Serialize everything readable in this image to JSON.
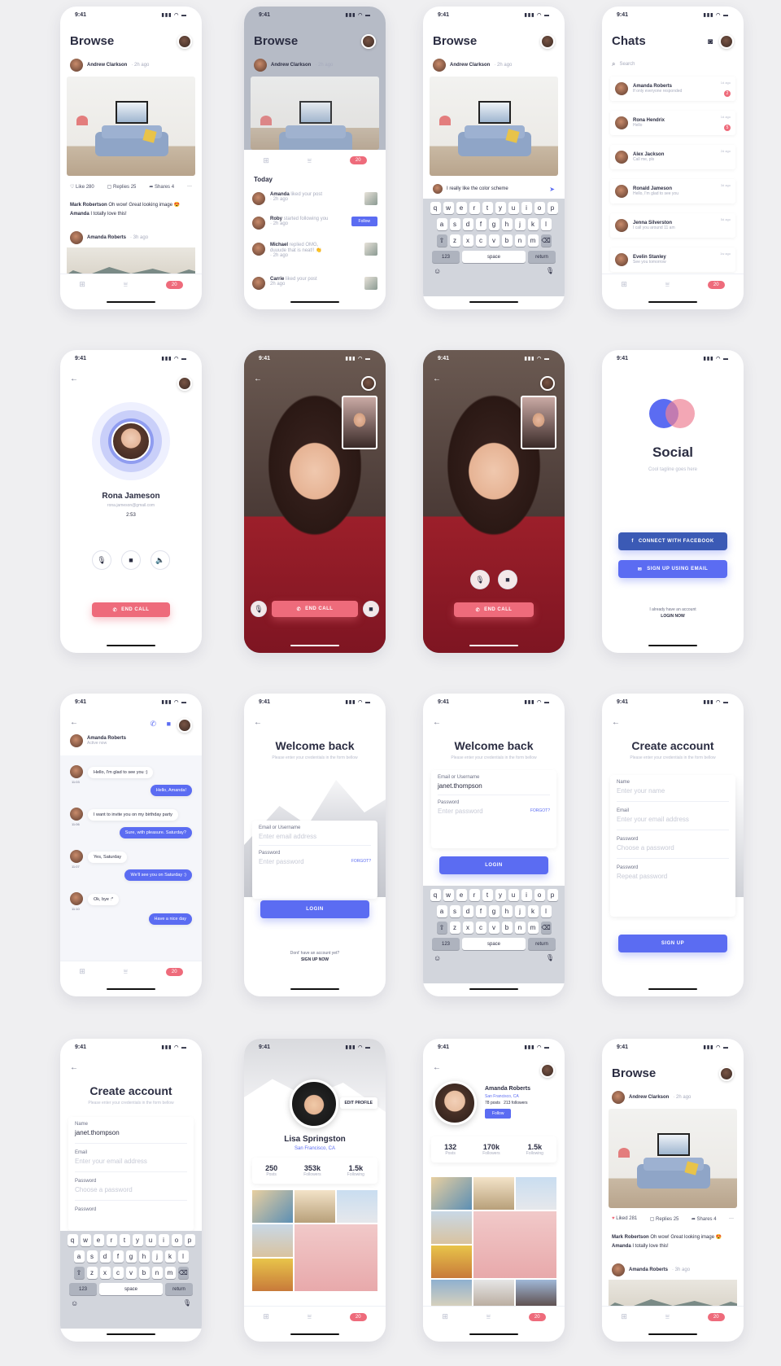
{
  "status": {
    "time": "9:41",
    "icons": "▮▮▮ ◠ ▬"
  },
  "tabs": {
    "grid": "⊞",
    "filter": "⩸",
    "badge": "20"
  },
  "browse": {
    "title": "Browse",
    "author": "Andrew Clarkson",
    "time": "· 2h ago",
    "likes": "Like 280",
    "liked": "Liked 281",
    "replies": "Replies 25",
    "shares": "Shares 4",
    "more": "···",
    "c1_name": "Mark Robertson",
    "c1_text": " Oh wow! Great looking image 😍",
    "c2_name": "Amanda",
    "c2_text": " I totally love this!",
    "next_author": "Amanda Roberts",
    "next_time": "· 3h ago"
  },
  "notifs": {
    "today": "Today",
    "follow": "Follow",
    "items": [
      {
        "name": "Amanda",
        "text": " liked your post",
        "time": "· 2h ago"
      },
      {
        "name": "Roby",
        "text": " started following you",
        "time": "· 2h ago"
      },
      {
        "name": "Michael",
        "text": " replied OMG, duuude that is neat!! 👏",
        "time": "· 2h ago"
      },
      {
        "name": "Carrie",
        "text": " liked your post",
        "time": "2h ago"
      }
    ]
  },
  "compose": {
    "text": "I really like the color scheme"
  },
  "keyboard": {
    "row1": [
      "q",
      "w",
      "e",
      "r",
      "t",
      "y",
      "u",
      "i",
      "o",
      "p"
    ],
    "row2": [
      "a",
      "s",
      "d",
      "f",
      "g",
      "h",
      "j",
      "k",
      "l"
    ],
    "row3": [
      "z",
      "x",
      "c",
      "v",
      "b",
      "n",
      "m"
    ],
    "num": "123",
    "space": "space",
    "ret": "return",
    "shift": "⇧",
    "del": "⌫",
    "emoji": "☺",
    "mic": "🎙"
  },
  "chats": {
    "title": "Chats",
    "search": "Search",
    "items": [
      {
        "name": "Amanda Roberts",
        "msg": "If only everyone responded",
        "time": "1d ago",
        "badge": "2"
      },
      {
        "name": "Rona Hendrix",
        "msg": "Hello",
        "time": "1d ago",
        "badge": "5"
      },
      {
        "name": "Alex Jackson",
        "msg": "Call me, pls",
        "time": "2d ago",
        "badge": ""
      },
      {
        "name": "Ronald Jameson",
        "msg": "Hello, I'm glad to see you",
        "time": "3d ago",
        "badge": ""
      },
      {
        "name": "Jenna Silverston",
        "msg": "I call you around 11 am",
        "time": "5d ago",
        "badge": ""
      },
      {
        "name": "Evelin Stanley",
        "msg": "See you tomorrow",
        "time": "1w ago",
        "badge": ""
      }
    ]
  },
  "call": {
    "name": "Rona Jameson",
    "email": "rona.jameson@gmail.com",
    "duration": "2:53",
    "end": "END CALL"
  },
  "social": {
    "title": "Social",
    "tagline": "Cool tagline goes here",
    "facebook": "CONNECT WITH FACEBOOK",
    "email": "SIGN UP USING EMAIL",
    "have": "I already have an account",
    "login": "LOGIN NOW"
  },
  "conv": {
    "name": "Amanda Roberts",
    "status": "Active now",
    "msgs": [
      {
        "text": "Hello, I'm glad to see you :)",
        "me": false,
        "time": "11:03"
      },
      {
        "text": "Hello, Amanda!",
        "me": true,
        "time": ""
      },
      {
        "text": "I want to invite you on my birthday party",
        "me": false,
        "time": "11:06"
      },
      {
        "text": "Sure, with pleasure. Saturday?",
        "me": true,
        "time": ""
      },
      {
        "text": "Yes, Saturday",
        "me": false,
        "time": "11:07"
      },
      {
        "text": "We'll see you on Saturday :)",
        "me": true,
        "time": ""
      },
      {
        "text": "Ok, bye :*",
        "me": false,
        "time": "11:10"
      },
      {
        "text": "Have a nice day",
        "me": true,
        "time": ""
      }
    ]
  },
  "login": {
    "title": "Welcome back",
    "sub": "Please enter your credentials in the form bellow",
    "email_label": "Email or Username",
    "email_ph": "Enter email address",
    "email_val": "janet.thompson",
    "pass_label": "Password",
    "pass_ph": "Enter password",
    "forgot": "FORGOT?",
    "btn": "LOGIN",
    "no_acc": "Dont' have an account yet?",
    "signup": "SIGN UP NOW"
  },
  "create": {
    "title": "Create account",
    "sub": "Please enter your credentials in the form bellow",
    "name_label": "Name",
    "name_ph": "Enter your name",
    "name_val": "janet.thompson",
    "email_label": "Email",
    "email_ph": "Enter your email address",
    "pass_label": "Password",
    "pass_ph": "Choose a password",
    "rep_label": "Password",
    "rep_ph": "Repeat password",
    "btn": "SIGN UP"
  },
  "profile1": {
    "name": "Lisa Springston",
    "loc": "San Francisco, CA",
    "edit": "EDIT PROFILE",
    "stats": [
      {
        "n": "250",
        "l": "Posts"
      },
      {
        "n": "353k",
        "l": "Followers"
      },
      {
        "n": "1.5k",
        "l": "Following"
      }
    ]
  },
  "profile2": {
    "name": "Amanda Roberts",
    "loc": "San Francisco, CA",
    "posts": "78 posts",
    "followers": "213 followers",
    "follow": "Follow",
    "stats": [
      {
        "n": "132",
        "l": "Posts"
      },
      {
        "n": "170k",
        "l": "Followers"
      },
      {
        "n": "1.5k",
        "l": "Following"
      }
    ]
  },
  "colors": {
    "accent": "#5b6cf2",
    "red": "#ee6b7b",
    "fb": "#3b5ab5"
  }
}
